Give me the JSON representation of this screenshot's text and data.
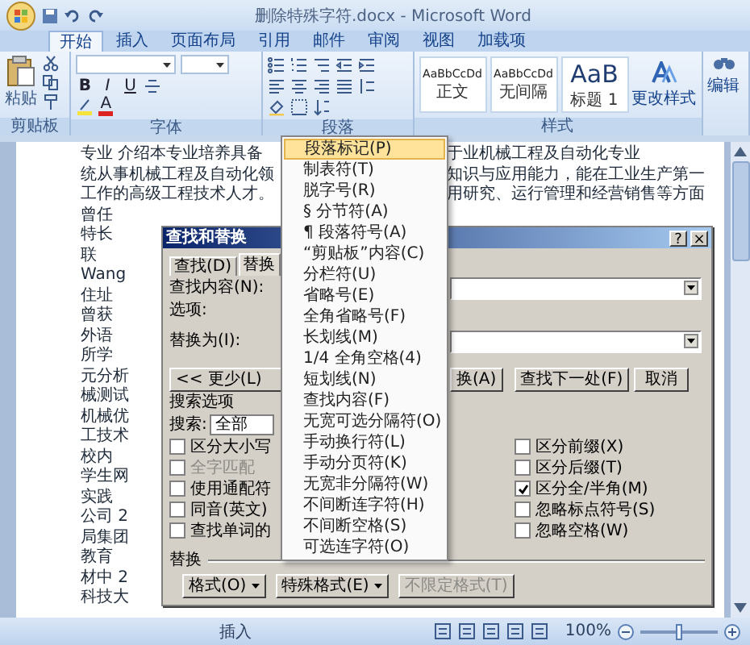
{
  "window": {
    "title": "删除特殊字符.docx - Microsoft Word"
  },
  "ribbon_tabs": [
    {
      "label": "开始",
      "selected": true
    },
    {
      "label": "插入",
      "selected": false
    },
    {
      "label": "页面布局",
      "selected": false
    },
    {
      "label": "引用",
      "selected": false
    },
    {
      "label": "邮件",
      "selected": false
    },
    {
      "label": "审阅",
      "selected": false
    },
    {
      "label": "视图",
      "selected": false
    },
    {
      "label": "加载项",
      "selected": false
    }
  ],
  "ribbon": {
    "clipboard": {
      "paste_label": "粘贴",
      "group_label": "剪贴板"
    },
    "font": {
      "group_label": "字体",
      "format_buttons": [
        "B",
        "I",
        "U"
      ],
      "font_color_glyph": "A"
    },
    "paragraph": {
      "group_label": "段落"
    },
    "styles": {
      "group_label": "样式",
      "items": [
        {
          "sample": "AaBbCcDd",
          "name": "正文",
          "large": false
        },
        {
          "sample": "AaBbCcDd",
          "name": "无间隔",
          "large": false
        },
        {
          "sample": "AaB",
          "name": "标题 1",
          "large": true
        }
      ],
      "change_styles": "更改样式"
    },
    "editing": {
      "label": "编辑"
    }
  },
  "document": {
    "lines": [
      {
        "left": "专业 介绍本专业培养具备",
        "right": "于业机械工程及自动化专业"
      },
      {
        "left": "统从事机械工程及自动化领",
        "right": "知识与应用能力，能在工业生产第一"
      },
      {
        "left": "工作的高级工程技术人才。",
        "right": "用研究、运行管理和经营销售等方面"
      },
      {
        "left": "曾任"
      },
      {
        "left": "特长"
      },
      {
        "left": "联"
      },
      {
        "left": "Wang"
      },
      {
        "left": "住址"
      },
      {
        "left": "曾获"
      },
      {
        "left": "外语"
      },
      {
        "left": "所学"
      },
      {
        "left": "元分析"
      },
      {
        "left": "械测试"
      },
      {
        "left": "机械优"
      },
      {
        "left": "工技术"
      },
      {
        "left": "校内"
      },
      {
        "left": "学生网"
      },
      {
        "left": "实践"
      },
      {
        "left": "公司 2"
      },
      {
        "left": "局集团"
      },
      {
        "left": "教育"
      },
      {
        "left": "材中 2"
      },
      {
        "left": "科技大"
      }
    ]
  },
  "dialog": {
    "title": "查找和替换",
    "help_glyph": "?",
    "close_glyph": "×",
    "tabs": [
      {
        "label": "查找(D)",
        "selected": false
      },
      {
        "label": "替换",
        "selected": true
      }
    ],
    "find_label": "查找内容(N):",
    "options_label": "选项:",
    "replace_label": "替换为(I):",
    "less_button": "<< 更少(L)",
    "action_buttons": [
      "换(A)",
      "查找下一处(F)",
      "取消"
    ],
    "search_options_label": "搜索选项",
    "search_label": "搜索:",
    "search_value": "全部",
    "options_left": [
      {
        "label": "区分大小写",
        "checked": false,
        "disabled": false
      },
      {
        "label": "全字匹配",
        "checked": false,
        "disabled": true
      },
      {
        "label": "使用通配符",
        "checked": false,
        "disabled": false
      },
      {
        "label": "同音(英文)",
        "checked": false,
        "disabled": false
      },
      {
        "label": "查找单词的",
        "checked": false,
        "disabled": false
      }
    ],
    "options_right": [
      {
        "label": "区分前缀(X)",
        "checked": false,
        "disabled": false
      },
      {
        "label": "区分后缀(T)",
        "checked": false,
        "disabled": false
      },
      {
        "label": "区分全/半角(M)",
        "checked": true,
        "disabled": false
      },
      {
        "label": "忽略标点符号(S)",
        "checked": false,
        "disabled": false
      },
      {
        "label": "忽略空格(W)",
        "checked": false,
        "disabled": false
      }
    ],
    "replace_section_label": "替换",
    "bottom_buttons": [
      {
        "label": "格式(O)",
        "dropdown": true,
        "disabled": false
      },
      {
        "label": "特殊格式(E)",
        "dropdown": true,
        "disabled": false
      },
      {
        "label": "不限定格式(T)",
        "dropdown": false,
        "disabled": true
      }
    ]
  },
  "menu": {
    "items": [
      {
        "label": "段落标记(P)",
        "selected": true
      },
      {
        "label": "制表符(T)",
        "selected": false
      },
      {
        "label": "脱字号(R)",
        "selected": false
      },
      {
        "label": "§ 分节符(A)",
        "selected": false
      },
      {
        "label": "¶ 段落符号(A)",
        "selected": false
      },
      {
        "label": "“剪贴板”内容(C)",
        "selected": false
      },
      {
        "label": "分栏符(U)",
        "selected": false
      },
      {
        "label": "省略号(E)",
        "selected": false
      },
      {
        "label": "全角省略号(F)",
        "selected": false
      },
      {
        "label": "长划线(M)",
        "selected": false
      },
      {
        "label": "1/4 全角空格(4)",
        "selected": false
      },
      {
        "label": "短划线(N)",
        "selected": false
      },
      {
        "label": "查找内容(F)",
        "selected": false
      },
      {
        "label": "无宽可选分隔符(O)",
        "selected": false
      },
      {
        "label": "手动换行符(L)",
        "selected": false
      },
      {
        "label": "手动分页符(K)",
        "selected": false
      },
      {
        "label": "无宽非分隔符(W)",
        "selected": false
      },
      {
        "label": "不间断连字符(H)",
        "selected": false
      },
      {
        "label": "不间断空格(S)",
        "selected": false
      },
      {
        "label": "可选连字符(O)",
        "selected": false
      }
    ]
  },
  "status_bar": {
    "mode": "插入",
    "zoom": "100%",
    "zoom_slider": {
      "level": 0.5
    }
  }
}
